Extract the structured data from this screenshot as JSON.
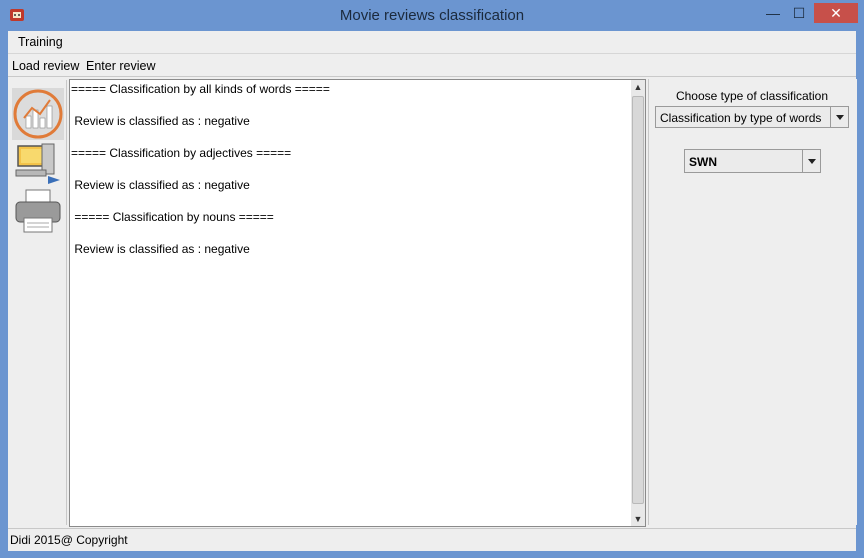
{
  "window": {
    "title": "Movie reviews classification",
    "minimize_glyph": "—",
    "maximize_glyph": "☐",
    "close_glyph": "✕"
  },
  "menu": {
    "items": [
      {
        "label": "Training"
      }
    ]
  },
  "toolbar": {
    "load_review": "Load review",
    "enter_review": "Enter review"
  },
  "output": {
    "lines": [
      "===== Classification by all kinds of words =====",
      " Review is classified as : negative",
      "===== Classification by adjectives =====",
      " Review is classified as : negative",
      " ===== Classification by nouns =====",
      " Review is classified as : negative"
    ]
  },
  "right_panel": {
    "choose_label": "Choose type of classification",
    "classification_type": "Classification by type of words",
    "method": "SWN"
  },
  "status": {
    "text": "Didi 2015@ Copyright"
  },
  "icons": [
    "app-icon",
    "chart-icon",
    "computer-icon",
    "printer-icon"
  ]
}
